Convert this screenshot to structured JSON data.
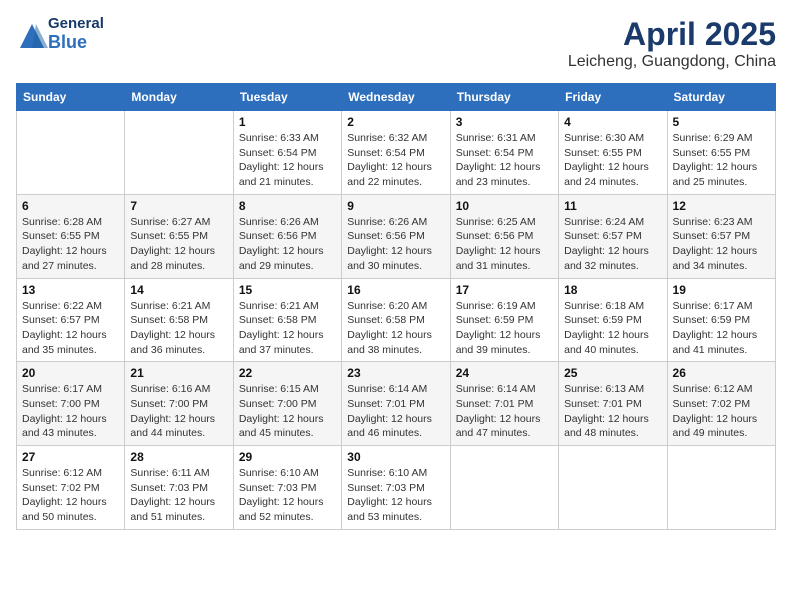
{
  "header": {
    "logo": {
      "general": "General",
      "blue": "Blue"
    },
    "title": "April 2025",
    "location": "Leicheng, Guangdong, China"
  },
  "days_of_week": [
    "Sunday",
    "Monday",
    "Tuesday",
    "Wednesday",
    "Thursday",
    "Friday",
    "Saturday"
  ],
  "weeks": [
    [
      null,
      null,
      {
        "day": 1,
        "sunrise": "6:33 AM",
        "sunset": "6:54 PM",
        "daylight": "12 hours and 21 minutes."
      },
      {
        "day": 2,
        "sunrise": "6:32 AM",
        "sunset": "6:54 PM",
        "daylight": "12 hours and 22 minutes."
      },
      {
        "day": 3,
        "sunrise": "6:31 AM",
        "sunset": "6:54 PM",
        "daylight": "12 hours and 23 minutes."
      },
      {
        "day": 4,
        "sunrise": "6:30 AM",
        "sunset": "6:55 PM",
        "daylight": "12 hours and 24 minutes."
      },
      {
        "day": 5,
        "sunrise": "6:29 AM",
        "sunset": "6:55 PM",
        "daylight": "12 hours and 25 minutes."
      }
    ],
    [
      {
        "day": 6,
        "sunrise": "6:28 AM",
        "sunset": "6:55 PM",
        "daylight": "12 hours and 27 minutes."
      },
      {
        "day": 7,
        "sunrise": "6:27 AM",
        "sunset": "6:55 PM",
        "daylight": "12 hours and 28 minutes."
      },
      {
        "day": 8,
        "sunrise": "6:26 AM",
        "sunset": "6:56 PM",
        "daylight": "12 hours and 29 minutes."
      },
      {
        "day": 9,
        "sunrise": "6:26 AM",
        "sunset": "6:56 PM",
        "daylight": "12 hours and 30 minutes."
      },
      {
        "day": 10,
        "sunrise": "6:25 AM",
        "sunset": "6:56 PM",
        "daylight": "12 hours and 31 minutes."
      },
      {
        "day": 11,
        "sunrise": "6:24 AM",
        "sunset": "6:57 PM",
        "daylight": "12 hours and 32 minutes."
      },
      {
        "day": 12,
        "sunrise": "6:23 AM",
        "sunset": "6:57 PM",
        "daylight": "12 hours and 34 minutes."
      }
    ],
    [
      {
        "day": 13,
        "sunrise": "6:22 AM",
        "sunset": "6:57 PM",
        "daylight": "12 hours and 35 minutes."
      },
      {
        "day": 14,
        "sunrise": "6:21 AM",
        "sunset": "6:58 PM",
        "daylight": "12 hours and 36 minutes."
      },
      {
        "day": 15,
        "sunrise": "6:21 AM",
        "sunset": "6:58 PM",
        "daylight": "12 hours and 37 minutes."
      },
      {
        "day": 16,
        "sunrise": "6:20 AM",
        "sunset": "6:58 PM",
        "daylight": "12 hours and 38 minutes."
      },
      {
        "day": 17,
        "sunrise": "6:19 AM",
        "sunset": "6:59 PM",
        "daylight": "12 hours and 39 minutes."
      },
      {
        "day": 18,
        "sunrise": "6:18 AM",
        "sunset": "6:59 PM",
        "daylight": "12 hours and 40 minutes."
      },
      {
        "day": 19,
        "sunrise": "6:17 AM",
        "sunset": "6:59 PM",
        "daylight": "12 hours and 41 minutes."
      }
    ],
    [
      {
        "day": 20,
        "sunrise": "6:17 AM",
        "sunset": "7:00 PM",
        "daylight": "12 hours and 43 minutes."
      },
      {
        "day": 21,
        "sunrise": "6:16 AM",
        "sunset": "7:00 PM",
        "daylight": "12 hours and 44 minutes."
      },
      {
        "day": 22,
        "sunrise": "6:15 AM",
        "sunset": "7:00 PM",
        "daylight": "12 hours and 45 minutes."
      },
      {
        "day": 23,
        "sunrise": "6:14 AM",
        "sunset": "7:01 PM",
        "daylight": "12 hours and 46 minutes."
      },
      {
        "day": 24,
        "sunrise": "6:14 AM",
        "sunset": "7:01 PM",
        "daylight": "12 hours and 47 minutes."
      },
      {
        "day": 25,
        "sunrise": "6:13 AM",
        "sunset": "7:01 PM",
        "daylight": "12 hours and 48 minutes."
      },
      {
        "day": 26,
        "sunrise": "6:12 AM",
        "sunset": "7:02 PM",
        "daylight": "12 hours and 49 minutes."
      }
    ],
    [
      {
        "day": 27,
        "sunrise": "6:12 AM",
        "sunset": "7:02 PM",
        "daylight": "12 hours and 50 minutes."
      },
      {
        "day": 28,
        "sunrise": "6:11 AM",
        "sunset": "7:03 PM",
        "daylight": "12 hours and 51 minutes."
      },
      {
        "day": 29,
        "sunrise": "6:10 AM",
        "sunset": "7:03 PM",
        "daylight": "12 hours and 52 minutes."
      },
      {
        "day": 30,
        "sunrise": "6:10 AM",
        "sunset": "7:03 PM",
        "daylight": "12 hours and 53 minutes."
      },
      null,
      null,
      null
    ]
  ]
}
